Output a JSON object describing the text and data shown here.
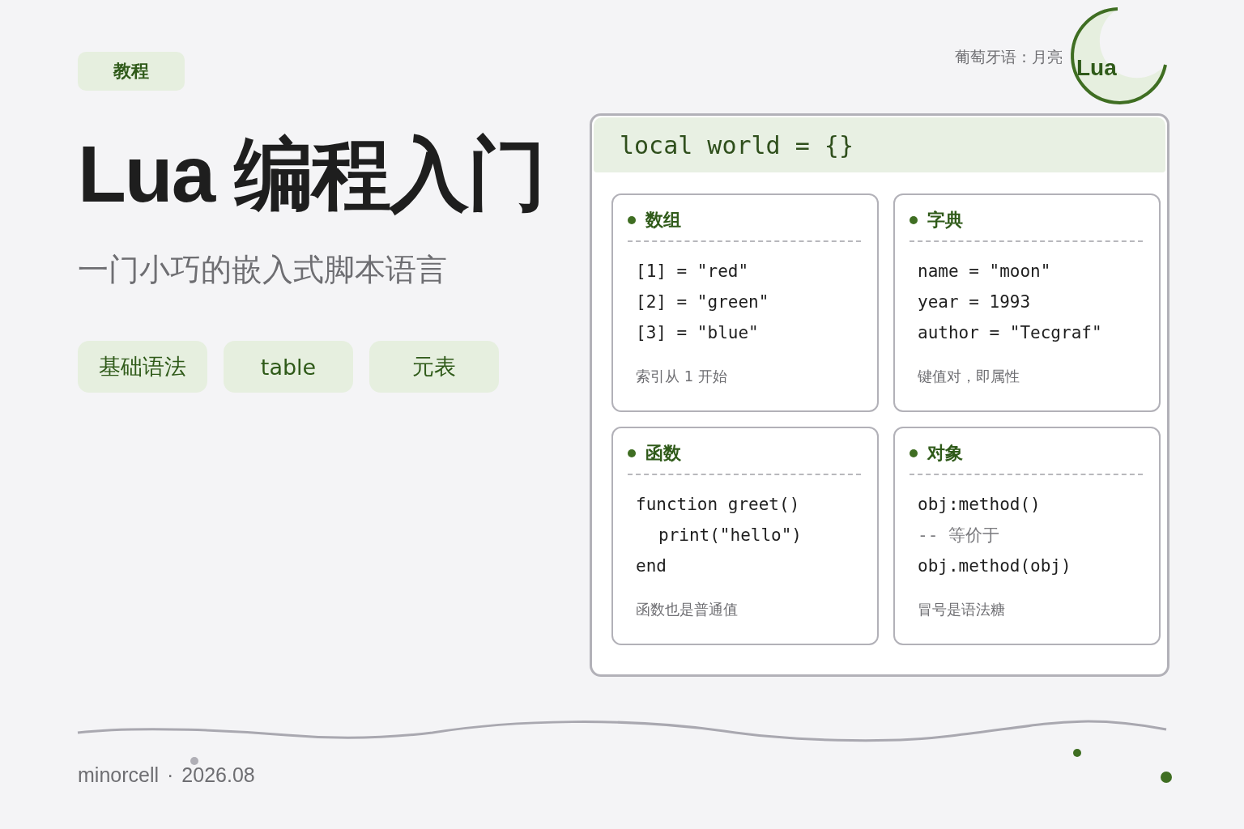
{
  "tag": "教程",
  "title": "Lua 编程入门",
  "subtitle": "一门小巧的嵌入式脚本语言",
  "chips": [
    "基础语法",
    "table",
    "元表"
  ],
  "moon_note": "葡萄牙语：月亮",
  "logo": "Lua",
  "panel": {
    "header": "local world = {}",
    "cards": [
      {
        "title": "数组",
        "lines": [
          {
            "kind": "code",
            "text": "[1] = \"red\""
          },
          {
            "kind": "code",
            "text": "[2] = \"green\""
          },
          {
            "kind": "code",
            "text": "[3] = \"blue\""
          }
        ],
        "note": "索引从 1 开始"
      },
      {
        "title": "字典",
        "lines": [
          {
            "kind": "code",
            "text": "name = \"moon\""
          },
          {
            "kind": "code",
            "text": "year = 1993"
          },
          {
            "kind": "code",
            "text": "author = \"Tecgraf\""
          }
        ],
        "note": "键值对，即属性"
      },
      {
        "title": "函数",
        "lines": [
          {
            "kind": "code",
            "text": "function greet()",
            "children": [
              {
                "kind": "code",
                "text": "print(\"hello\")"
              }
            ]
          },
          {
            "kind": "code",
            "text": "end"
          }
        ],
        "note": "函数也是普通值"
      },
      {
        "title": "对象",
        "lines": [
          {
            "kind": "code",
            "text": "obj:method()"
          },
          {
            "kind": "comment",
            "text": "-- 等价于"
          },
          {
            "kind": "code",
            "text": "obj.method(obj)"
          }
        ],
        "note": "冒号是语法糖"
      }
    ]
  },
  "footer": {
    "author": "minorcell",
    "separator": "·",
    "date": "2026.08"
  }
}
